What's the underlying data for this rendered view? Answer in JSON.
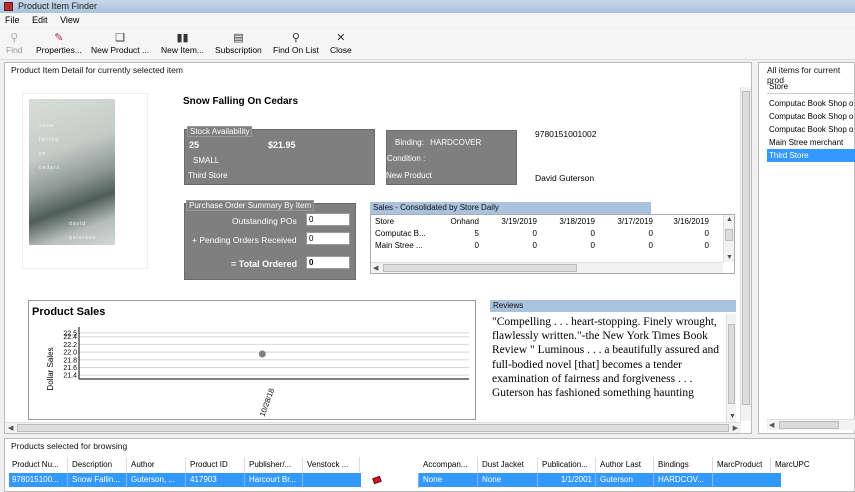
{
  "window": {
    "title": "Product Item Finder"
  },
  "menu": [
    "File",
    "Edit",
    "View"
  ],
  "toolbar": [
    {
      "label": "Find",
      "icon": "binoculars-icon",
      "glyph": "⚲",
      "disabled": true
    },
    {
      "label": "Properties...",
      "icon": "properties-icon",
      "glyph": "✎",
      "disabled": false
    },
    {
      "label": "New Product ...",
      "icon": "new-product-icon",
      "glyph": "❑",
      "disabled": false
    },
    {
      "label": "New Item...",
      "icon": "new-item-icon",
      "glyph": "▮▮",
      "disabled": false
    },
    {
      "label": "Subscription",
      "icon": "subscription-icon",
      "glyph": "▤",
      "disabled": false
    },
    {
      "label": "Find On List",
      "icon": "binoculars-icon",
      "glyph": "⚲",
      "disabled": false
    },
    {
      "label": "Close",
      "icon": "close-icon",
      "glyph": "✕",
      "disabled": false
    }
  ],
  "detail": {
    "caption": "Product Item Detail for currently selected item",
    "book_title": "Snow Falling On Cedars",
    "cover_text": [
      "snow",
      "falling",
      "on",
      "cedars"
    ],
    "cover_author": "david guterson",
    "stock": {
      "legend": "Stock Availability",
      "quantity": "25",
      "price": "$21.95",
      "size": "SMALL",
      "store": "Third Store"
    },
    "binding": {
      "label": "Binding:",
      "value": "HARDCOVER",
      "condition_label": "Condition :",
      "condition_value": "New Product"
    },
    "isbn": "9780151001002",
    "author": "David Guterson",
    "po": {
      "legend": "Purchase Order Summary By Item",
      "outstanding_label": "Outstanding POs",
      "outstanding_value": "0",
      "pending_label": "+ Pending Orders Received",
      "pending_value": "0",
      "total_label": "= Total Ordered",
      "total_value": "0"
    },
    "sales": {
      "caption": "Sales - Consolidated by Store  Daily",
      "columns": [
        "Store",
        "Onhand",
        "3/19/2019",
        "3/18/2019",
        "3/17/2019",
        "3/16/2019"
      ],
      "rows": [
        [
          "Computac B...",
          "5",
          "0",
          "0",
          "0",
          "0"
        ],
        [
          "Main Stree ...",
          "0",
          "0",
          "0",
          "0",
          "0"
        ]
      ]
    },
    "reviews": {
      "caption": "Reviews",
      "text": "\"Compelling . . . heart-stopping. Finely wrought, flawlessly written.\"-the New York Times Book Review \" Luminous . . . a beautifully assured and full-bodied novel [that] becomes a tender examination of fairness and forgiveness . . . Guterson has fashioned something haunting"
    }
  },
  "chart_data": {
    "type": "scatter",
    "title": "Product Sales",
    "ylabel": "Dollar Sales",
    "xlabel": "",
    "x_ticks": [
      "10/28/18"
    ],
    "y_ticks": [
      "22.5",
      "22.4",
      "22.2",
      "22.0",
      "21.8",
      "21.6",
      "21.4"
    ],
    "ylim": [
      21.3,
      22.6
    ],
    "points": [
      {
        "x": "10/28/18",
        "y": 21.95
      }
    ],
    "point_color": "#808080",
    "grid": true
  },
  "right_panel": {
    "caption": "All items for current prod",
    "column": "Store",
    "items": [
      {
        "label": "Computac Book Shop o",
        "selected": false
      },
      {
        "label": "Computac Book Shop o",
        "selected": false
      },
      {
        "label": "Computac Book Shop o",
        "selected": false
      },
      {
        "label": "Main Stree merchant",
        "selected": false
      },
      {
        "label": "Third Store",
        "selected": true
      }
    ]
  },
  "browse": {
    "caption": "Products selected for browsing",
    "columns": [
      "Product Nu...",
      "Description",
      "Author",
      "Product ID",
      "Publisher/...",
      "Venstock ...",
      "",
      "Accompan...",
      "Dust Jacket",
      "Publication...",
      "Author Last",
      "Bindings",
      "MarcProduct",
      "MarcUPC"
    ],
    "row": [
      "978015100...",
      "Snow Fallin...",
      "Guterson, ...",
      "417903",
      "Harcourt Br...",
      "",
      "",
      "None",
      "None",
      "1/1/2001",
      "Guterson",
      "HARDCOV...",
      "",
      ""
    ]
  },
  "colors": {
    "selection": "#3399ff",
    "caption_bar": "#a9c2dd",
    "gray_box": "#7f7f7f"
  }
}
